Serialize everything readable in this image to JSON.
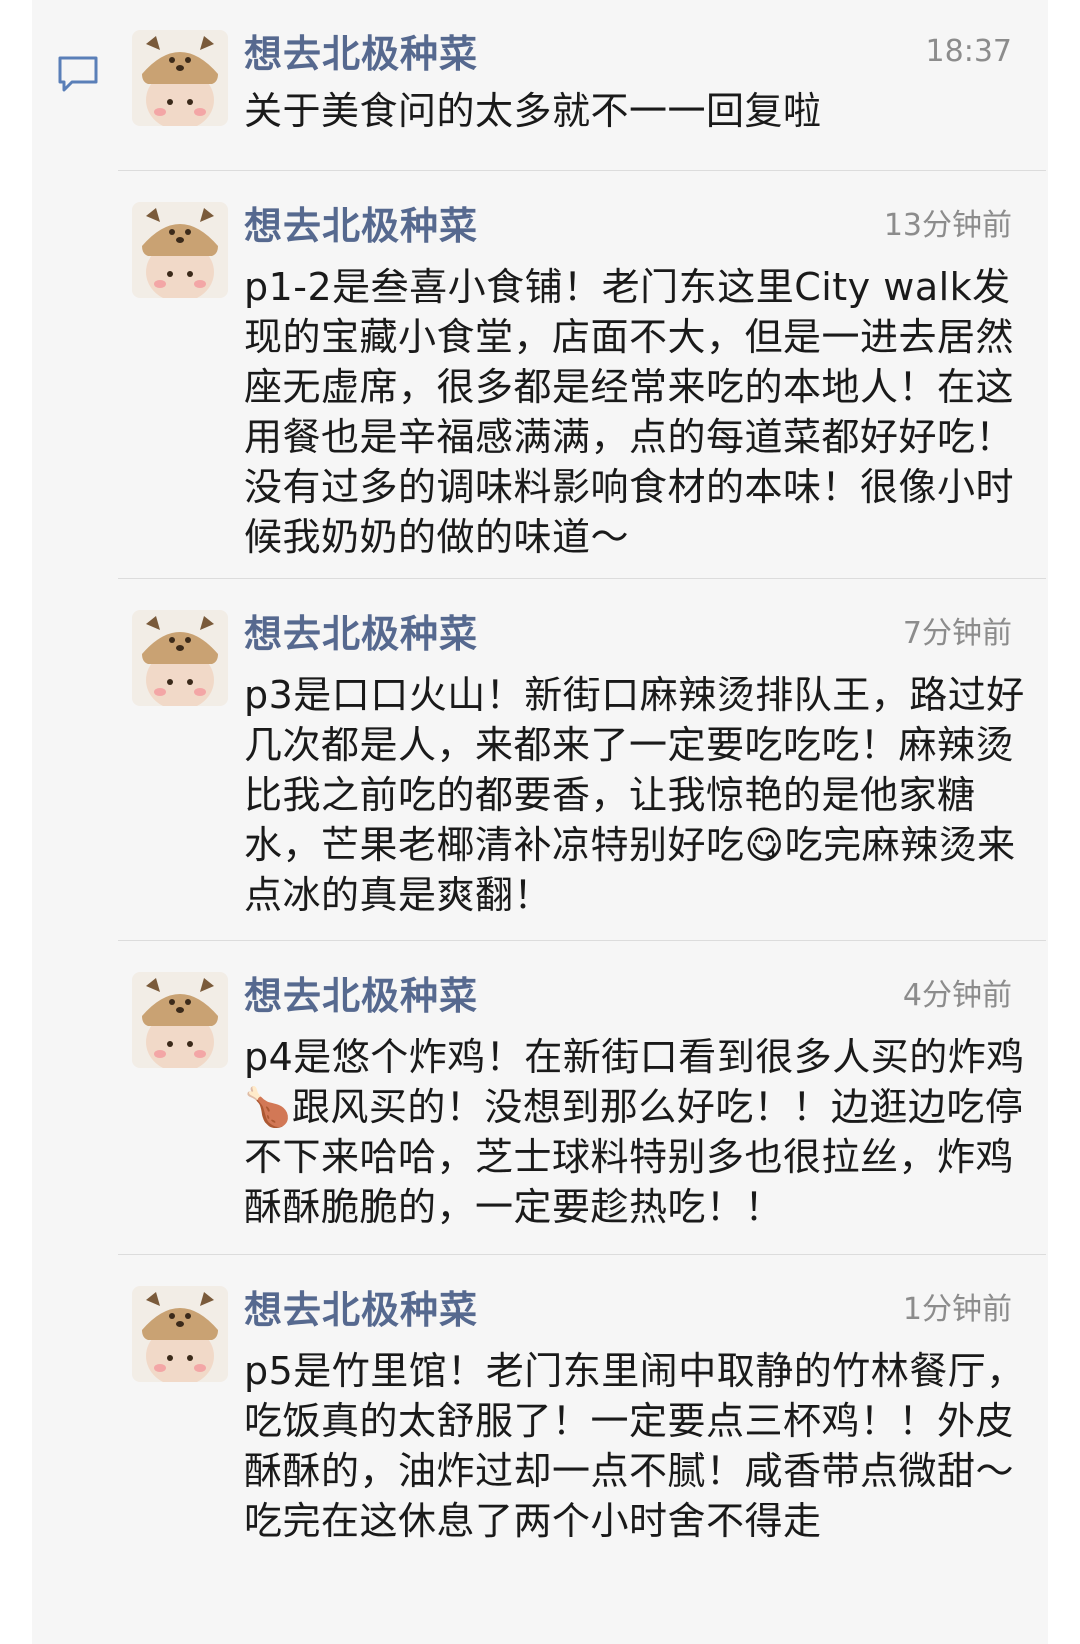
{
  "comments": [
    {
      "name": "想去北极种菜",
      "time": "18:37",
      "text": "关于美食问的太多就不一一回复啦"
    },
    {
      "name": "想去北极种菜",
      "time": "13分钟前",
      "text": "p1-2是叁喜小食铺！老门东这里City walk发现的宝藏小食堂，店面不大，但是一进去居然座无虚席，很多都是经常来吃的本地人！在这用餐也是辛福感满满，点的每道菜都好好吃！没有过多的调味料影响食材的本味！很像小时候我奶奶的做的味道～"
    },
    {
      "name": "想去北极种菜",
      "time": "7分钟前",
      "text": "p3是口口火山！新街口麻辣烫排队王，路过好几次都是人，来都来了一定要吃吃吃！麻辣烫比我之前吃的都要香，让我惊艳的是他家糖水，芒果老椰清补凉特别好吃😋吃完麻辣烫来点冰的真是爽翻！"
    },
    {
      "name": "想去北极种菜",
      "time": "4分钟前",
      "text": "p4是悠个炸鸡！在新街口看到很多人买的炸鸡🍗跟风买的！没想到那么好吃！！边逛边吃停不下来哈哈，芝士球料特别多也很拉丝，炸鸡酥酥脆脆的，一定要趁热吃！！"
    },
    {
      "name": "想去北极种菜",
      "time": "1分钟前",
      "text": "p5是竹里馆！老门东里闹中取静的竹林餐厅，吃饭真的太舒服了！一定要点三杯鸡！！外皮酥酥的，油炸过却一点不腻！咸香带点微甜～吃完在这休息了两个小时舍不得走"
    }
  ],
  "icons": {
    "comment": "comment-bubble-icon",
    "avatar": "avatar-bear-hat"
  },
  "colors": {
    "name": "#56698f",
    "time": "#8c8c8c",
    "text": "#1a1a1a",
    "background": "#f6f6f6"
  }
}
